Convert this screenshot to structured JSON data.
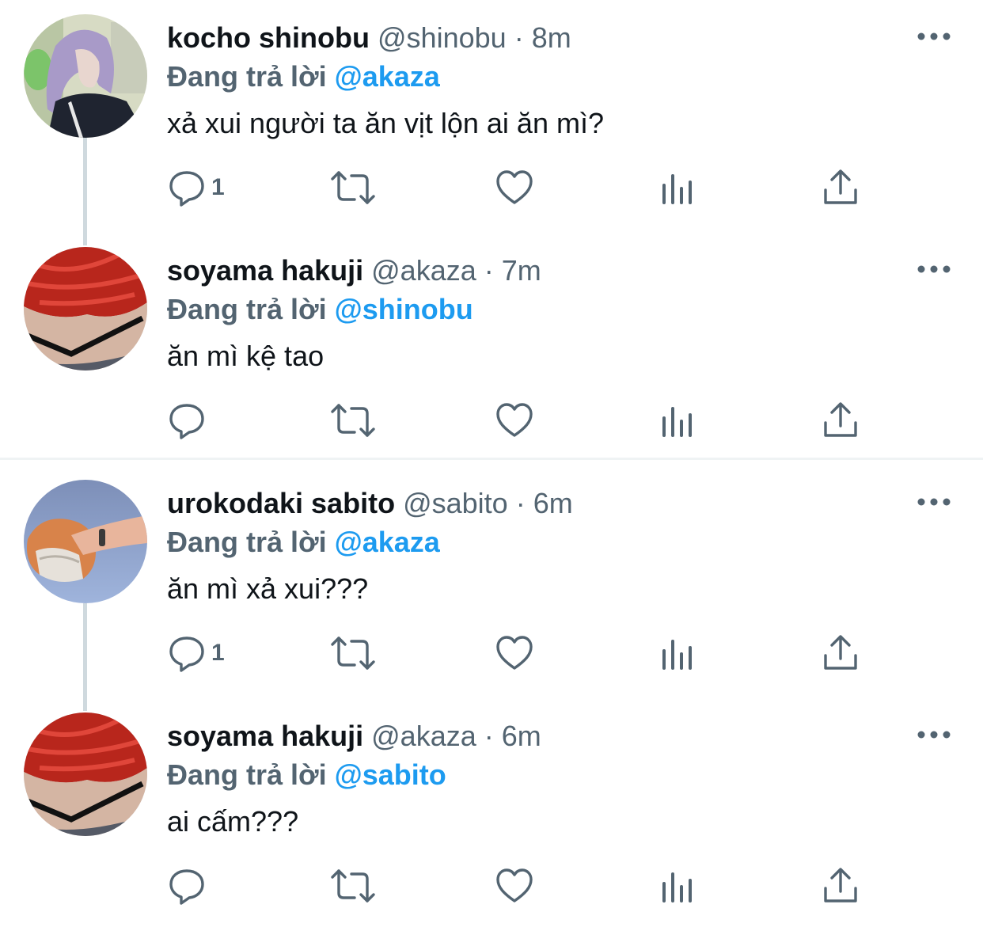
{
  "tweets": [
    {
      "name": "kocho shinobu",
      "handle": "@shinobu",
      "dot": "·",
      "time": "8m",
      "reply_prefix": "Đang trả lời",
      "reply_to": "@akaza",
      "text": "xả xui người ta ăn vịt lộn ai ăn mì?",
      "reply_count": "1",
      "avatar": "purple-hair-avatar"
    },
    {
      "name": "soyama hakuji",
      "handle": "@akaza",
      "dot": "·",
      "time": "7m",
      "reply_prefix": "Đang trả lời",
      "reply_to": "@shinobu",
      "text": "ăn mì kệ tao",
      "reply_count": "",
      "avatar": "red-hair-avatar"
    },
    {
      "name": "urokodaki sabito",
      "handle": "@sabito",
      "dot": "·",
      "time": "6m",
      "reply_prefix": "Đang trả lời",
      "reply_to": "@akaza",
      "text": "ăn mì xả xui???",
      "reply_count": "1",
      "avatar": "sky-masked-avatar"
    },
    {
      "name": "soyama hakuji",
      "handle": "@akaza",
      "dot": "·",
      "time": "6m",
      "reply_prefix": "Đang trả lời",
      "reply_to": "@sabito",
      "text": "ai cấm???",
      "reply_count": "",
      "avatar": "red-hair-avatar"
    }
  ],
  "icons": [
    "reply-icon",
    "retweet-icon",
    "like-icon",
    "views-icon",
    "share-icon",
    "more-icon"
  ],
  "colors": {
    "text": "#0f1419",
    "secondary": "#536471",
    "mention": "#1d9bf0",
    "thread_line": "#cfd9de"
  }
}
